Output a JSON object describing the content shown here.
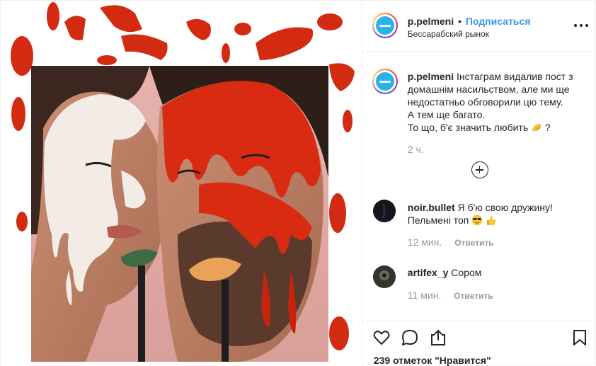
{
  "post": {
    "username": "p.pelmeni",
    "separator": "•",
    "follow_label": "Подписаться",
    "location": "Бессарабский рынок",
    "caption": {
      "username": "p.pelmeni",
      "lines": [
        "Інстаграм видалив пост з",
        "домашнім насильством, але ми ще",
        "недостатньо обговорили цю тему.",
        "А тем ще багато.",
        "То що, б'є значить любить"
      ],
      "line5_suffix": "?",
      "time": "2 ч."
    },
    "comments": [
      {
        "username": "noir.bullet",
        "text_line1": "Я б'ю свою дружину!",
        "text_line2": "Пельмені топ",
        "time": "12 мин.",
        "reply_label": "Ответить"
      },
      {
        "username": "artifex_y",
        "text_line1": "Сором",
        "time": "11 мин.",
        "reply_label": "Ответить"
      }
    ],
    "likes_label": "239 отметок \"Нравится\""
  },
  "icons": {
    "more": "more-options-icon",
    "load_more": "load-more-comments-icon",
    "like": "heart-icon",
    "comment": "comment-bubble-icon",
    "share": "share-icon",
    "save": "bookmark-icon",
    "taco_emoji": "taco-emoji",
    "sunglasses_emoji": "sunglasses-emoji",
    "thumbs_up_emoji": "thumbs-up-emoji"
  },
  "colors": {
    "link_blue": "#3897f0",
    "muted": "#999999",
    "text": "#262626",
    "ketchup": "#d92b12",
    "mayo": "#f4ede8",
    "backdrop_pink": "#e8b6b2"
  }
}
